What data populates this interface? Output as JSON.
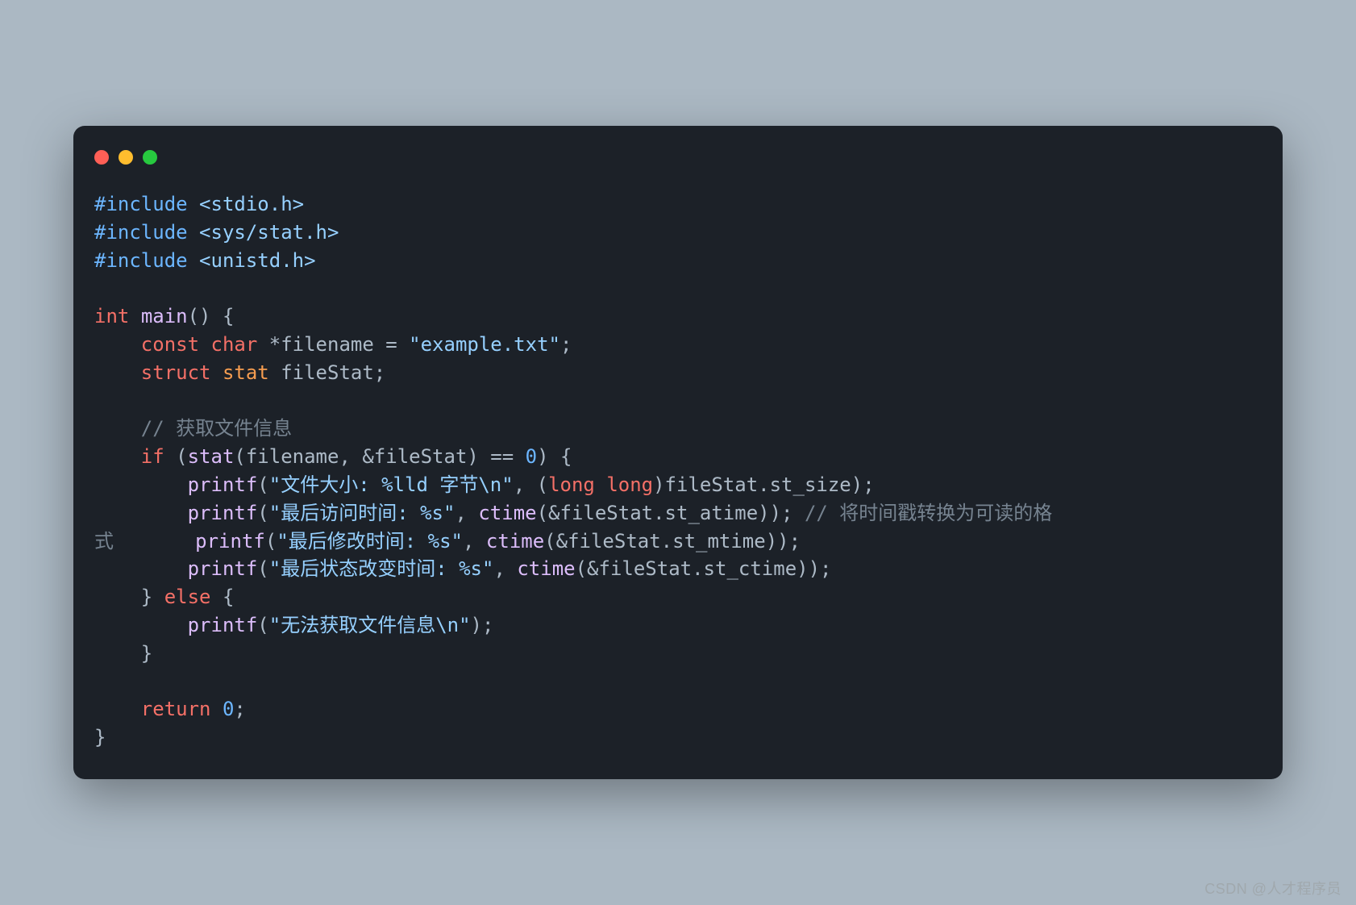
{
  "window": {
    "controls": [
      "close",
      "minimize",
      "zoom"
    ]
  },
  "code": {
    "lines": [
      {
        "tokens": [
          {
            "t": "#include",
            "c": "tok-pp"
          },
          {
            "t": " ",
            "c": "tok-pl"
          },
          {
            "t": "<stdio.h>",
            "c": "tok-str"
          }
        ]
      },
      {
        "tokens": [
          {
            "t": "#include",
            "c": "tok-pp"
          },
          {
            "t": " ",
            "c": "tok-pl"
          },
          {
            "t": "<sys/stat.h>",
            "c": "tok-str"
          }
        ]
      },
      {
        "tokens": [
          {
            "t": "#include",
            "c": "tok-pp"
          },
          {
            "t": " ",
            "c": "tok-pl"
          },
          {
            "t": "<unistd.h>",
            "c": "tok-str"
          }
        ]
      },
      {
        "tokens": []
      },
      {
        "tokens": [
          {
            "t": "int",
            "c": "tok-kw"
          },
          {
            "t": " ",
            "c": "tok-pl"
          },
          {
            "t": "main",
            "c": "tok-fn"
          },
          {
            "t": "() {",
            "c": "tok-pl"
          }
        ]
      },
      {
        "tokens": [
          {
            "t": "    ",
            "c": "tok-pl"
          },
          {
            "t": "const",
            "c": "tok-kw"
          },
          {
            "t": " ",
            "c": "tok-pl"
          },
          {
            "t": "char",
            "c": "tok-kw"
          },
          {
            "t": " *filename = ",
            "c": "tok-pl"
          },
          {
            "t": "\"example.txt\"",
            "c": "tok-str"
          },
          {
            "t": ";",
            "c": "tok-pl"
          }
        ]
      },
      {
        "tokens": [
          {
            "t": "    ",
            "c": "tok-pl"
          },
          {
            "t": "struct",
            "c": "tok-kw"
          },
          {
            "t": " ",
            "c": "tok-pl"
          },
          {
            "t": "stat",
            "c": "tok-type"
          },
          {
            "t": " fileStat;",
            "c": "tok-pl"
          }
        ]
      },
      {
        "tokens": []
      },
      {
        "tokens": [
          {
            "t": "    ",
            "c": "tok-pl"
          },
          {
            "t": "// 获取文件信息",
            "c": "tok-cm"
          }
        ]
      },
      {
        "tokens": [
          {
            "t": "    ",
            "c": "tok-pl"
          },
          {
            "t": "if",
            "c": "tok-kw"
          },
          {
            "t": " (",
            "c": "tok-pl"
          },
          {
            "t": "stat",
            "c": "tok-fn"
          },
          {
            "t": "(filename, &fileStat) == ",
            "c": "tok-pl"
          },
          {
            "t": "0",
            "c": "tok-num"
          },
          {
            "t": ") {",
            "c": "tok-pl"
          }
        ]
      },
      {
        "tokens": [
          {
            "t": "        ",
            "c": "tok-pl"
          },
          {
            "t": "printf",
            "c": "tok-fn"
          },
          {
            "t": "(",
            "c": "tok-pl"
          },
          {
            "t": "\"文件大小: %lld 字节\\n\"",
            "c": "tok-str"
          },
          {
            "t": ", (",
            "c": "tok-pl"
          },
          {
            "t": "long",
            "c": "tok-kw"
          },
          {
            "t": " ",
            "c": "tok-pl"
          },
          {
            "t": "long",
            "c": "tok-kw"
          },
          {
            "t": ")fileStat.st_size);",
            "c": "tok-pl"
          }
        ]
      },
      {
        "tokens": [
          {
            "t": "        ",
            "c": "tok-pl"
          },
          {
            "t": "printf",
            "c": "tok-fn"
          },
          {
            "t": "(",
            "c": "tok-pl"
          },
          {
            "t": "\"最后访问时间: %s\"",
            "c": "tok-str"
          },
          {
            "t": ", ",
            "c": "tok-pl"
          },
          {
            "t": "ctime",
            "c": "tok-fn"
          },
          {
            "t": "(&fileStat.st_atime)); ",
            "c": "tok-pl"
          },
          {
            "t": "// 将时间戳转换为可读的格",
            "c": "tok-cm"
          }
        ]
      },
      {
        "tokens": [
          {
            "t": "式",
            "c": "tok-cm"
          },
          {
            "t": "       ",
            "c": "tok-pl"
          },
          {
            "t": "printf",
            "c": "tok-fn"
          },
          {
            "t": "(",
            "c": "tok-pl"
          },
          {
            "t": "\"最后修改时间: %s\"",
            "c": "tok-str"
          },
          {
            "t": ", ",
            "c": "tok-pl"
          },
          {
            "t": "ctime",
            "c": "tok-fn"
          },
          {
            "t": "(&fileStat.st_mtime));",
            "c": "tok-pl"
          }
        ]
      },
      {
        "tokens": [
          {
            "t": "        ",
            "c": "tok-pl"
          },
          {
            "t": "printf",
            "c": "tok-fn"
          },
          {
            "t": "(",
            "c": "tok-pl"
          },
          {
            "t": "\"最后状态改变时间: %s\"",
            "c": "tok-str"
          },
          {
            "t": ", ",
            "c": "tok-pl"
          },
          {
            "t": "ctime",
            "c": "tok-fn"
          },
          {
            "t": "(&fileStat.st_ctime));",
            "c": "tok-pl"
          }
        ]
      },
      {
        "tokens": [
          {
            "t": "    } ",
            "c": "tok-pl"
          },
          {
            "t": "else",
            "c": "tok-kw"
          },
          {
            "t": " {",
            "c": "tok-pl"
          }
        ]
      },
      {
        "tokens": [
          {
            "t": "        ",
            "c": "tok-pl"
          },
          {
            "t": "printf",
            "c": "tok-fn"
          },
          {
            "t": "(",
            "c": "tok-pl"
          },
          {
            "t": "\"无法获取文件信息\\n\"",
            "c": "tok-str"
          },
          {
            "t": ");",
            "c": "tok-pl"
          }
        ]
      },
      {
        "tokens": [
          {
            "t": "    }",
            "c": "tok-pl"
          }
        ]
      },
      {
        "tokens": []
      },
      {
        "tokens": [
          {
            "t": "    ",
            "c": "tok-pl"
          },
          {
            "t": "return",
            "c": "tok-kw"
          },
          {
            "t": " ",
            "c": "tok-pl"
          },
          {
            "t": "0",
            "c": "tok-num"
          },
          {
            "t": ";",
            "c": "tok-pl"
          }
        ]
      },
      {
        "tokens": [
          {
            "t": "}",
            "c": "tok-pl"
          }
        ]
      }
    ]
  },
  "watermark": "CSDN @人才程序员"
}
